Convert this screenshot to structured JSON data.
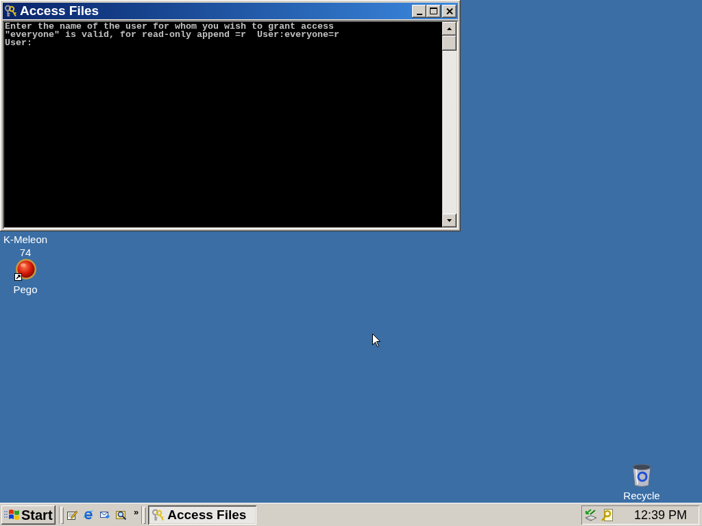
{
  "window": {
    "title": "Access Files",
    "console_lines": [
      "Enter the name of the user for whom you wish to grant access",
      "\"everyone\" is valid, for read-only append =r  User:everyone=r",
      "User:"
    ]
  },
  "desktop": {
    "left_icons": [
      {
        "kind": "label-only",
        "label": "K-Meleon 74"
      },
      {
        "kind": "shortcut",
        "label": "Pego"
      }
    ],
    "corner_icons": [
      {
        "kind": "recycle-bin",
        "label": "Recycle"
      }
    ]
  },
  "taskbar": {
    "start_button": "Start",
    "quick_launch_more": "»",
    "tasks": [
      {
        "label": "Access Files",
        "selected": true
      }
    ],
    "clock": "12:39 PM"
  }
}
